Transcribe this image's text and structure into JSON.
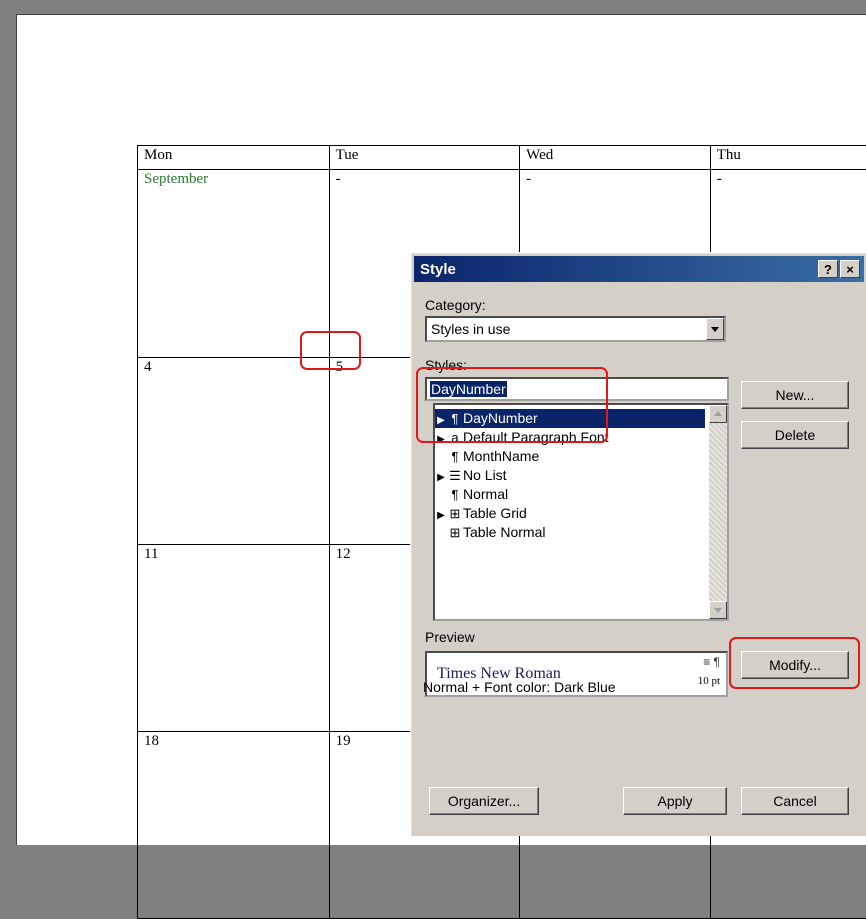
{
  "calendar": {
    "headers": [
      "Mon",
      "Tue",
      "Wed",
      "Thu"
    ],
    "rows": [
      [
        "September",
        "-",
        "-",
        "-"
      ],
      [
        "4",
        "5",
        "",
        ""
      ],
      [
        "11",
        "12",
        "",
        ""
      ],
      [
        "18",
        "19",
        "",
        ""
      ]
    ]
  },
  "dialog": {
    "title": "Style",
    "help_btn": "?",
    "close_btn": "×",
    "category_label": "Category:",
    "category_value": "Styles in use",
    "styles_label": "Styles:",
    "style_name_value": "DayNumber",
    "styles": [
      {
        "marker": "▶",
        "icon": "¶",
        "label": "DayNumber",
        "selected": true
      },
      {
        "marker": "▶",
        "icon": "a",
        "label": "Default Paragraph Font",
        "selected": false
      },
      {
        "marker": "",
        "icon": "¶",
        "label": "MonthName",
        "selected": false
      },
      {
        "marker": "▶",
        "icon": "☰",
        "label": "No List",
        "selected": false
      },
      {
        "marker": "",
        "icon": "¶",
        "label": "Normal",
        "selected": false
      },
      {
        "marker": "▶",
        "icon": "⊞",
        "label": "Table Grid",
        "selected": false
      },
      {
        "marker": "",
        "icon": "⊞",
        "label": "Table Normal",
        "selected": false
      }
    ],
    "buttons": {
      "new": "New...",
      "delete": "Delete",
      "modify": "Modify...",
      "organizer": "Organizer...",
      "apply": "Apply",
      "cancel": "Cancel"
    },
    "preview_label": "Preview",
    "preview_font": "Times New Roman",
    "preview_para_marks": "≡ ¶",
    "preview_size": "10 pt",
    "description": "Normal + Font color: Dark Blue"
  },
  "colors": {
    "highlight": "#e01818",
    "title_bar": "#0a246a",
    "month_text": "#2a7a2a"
  }
}
